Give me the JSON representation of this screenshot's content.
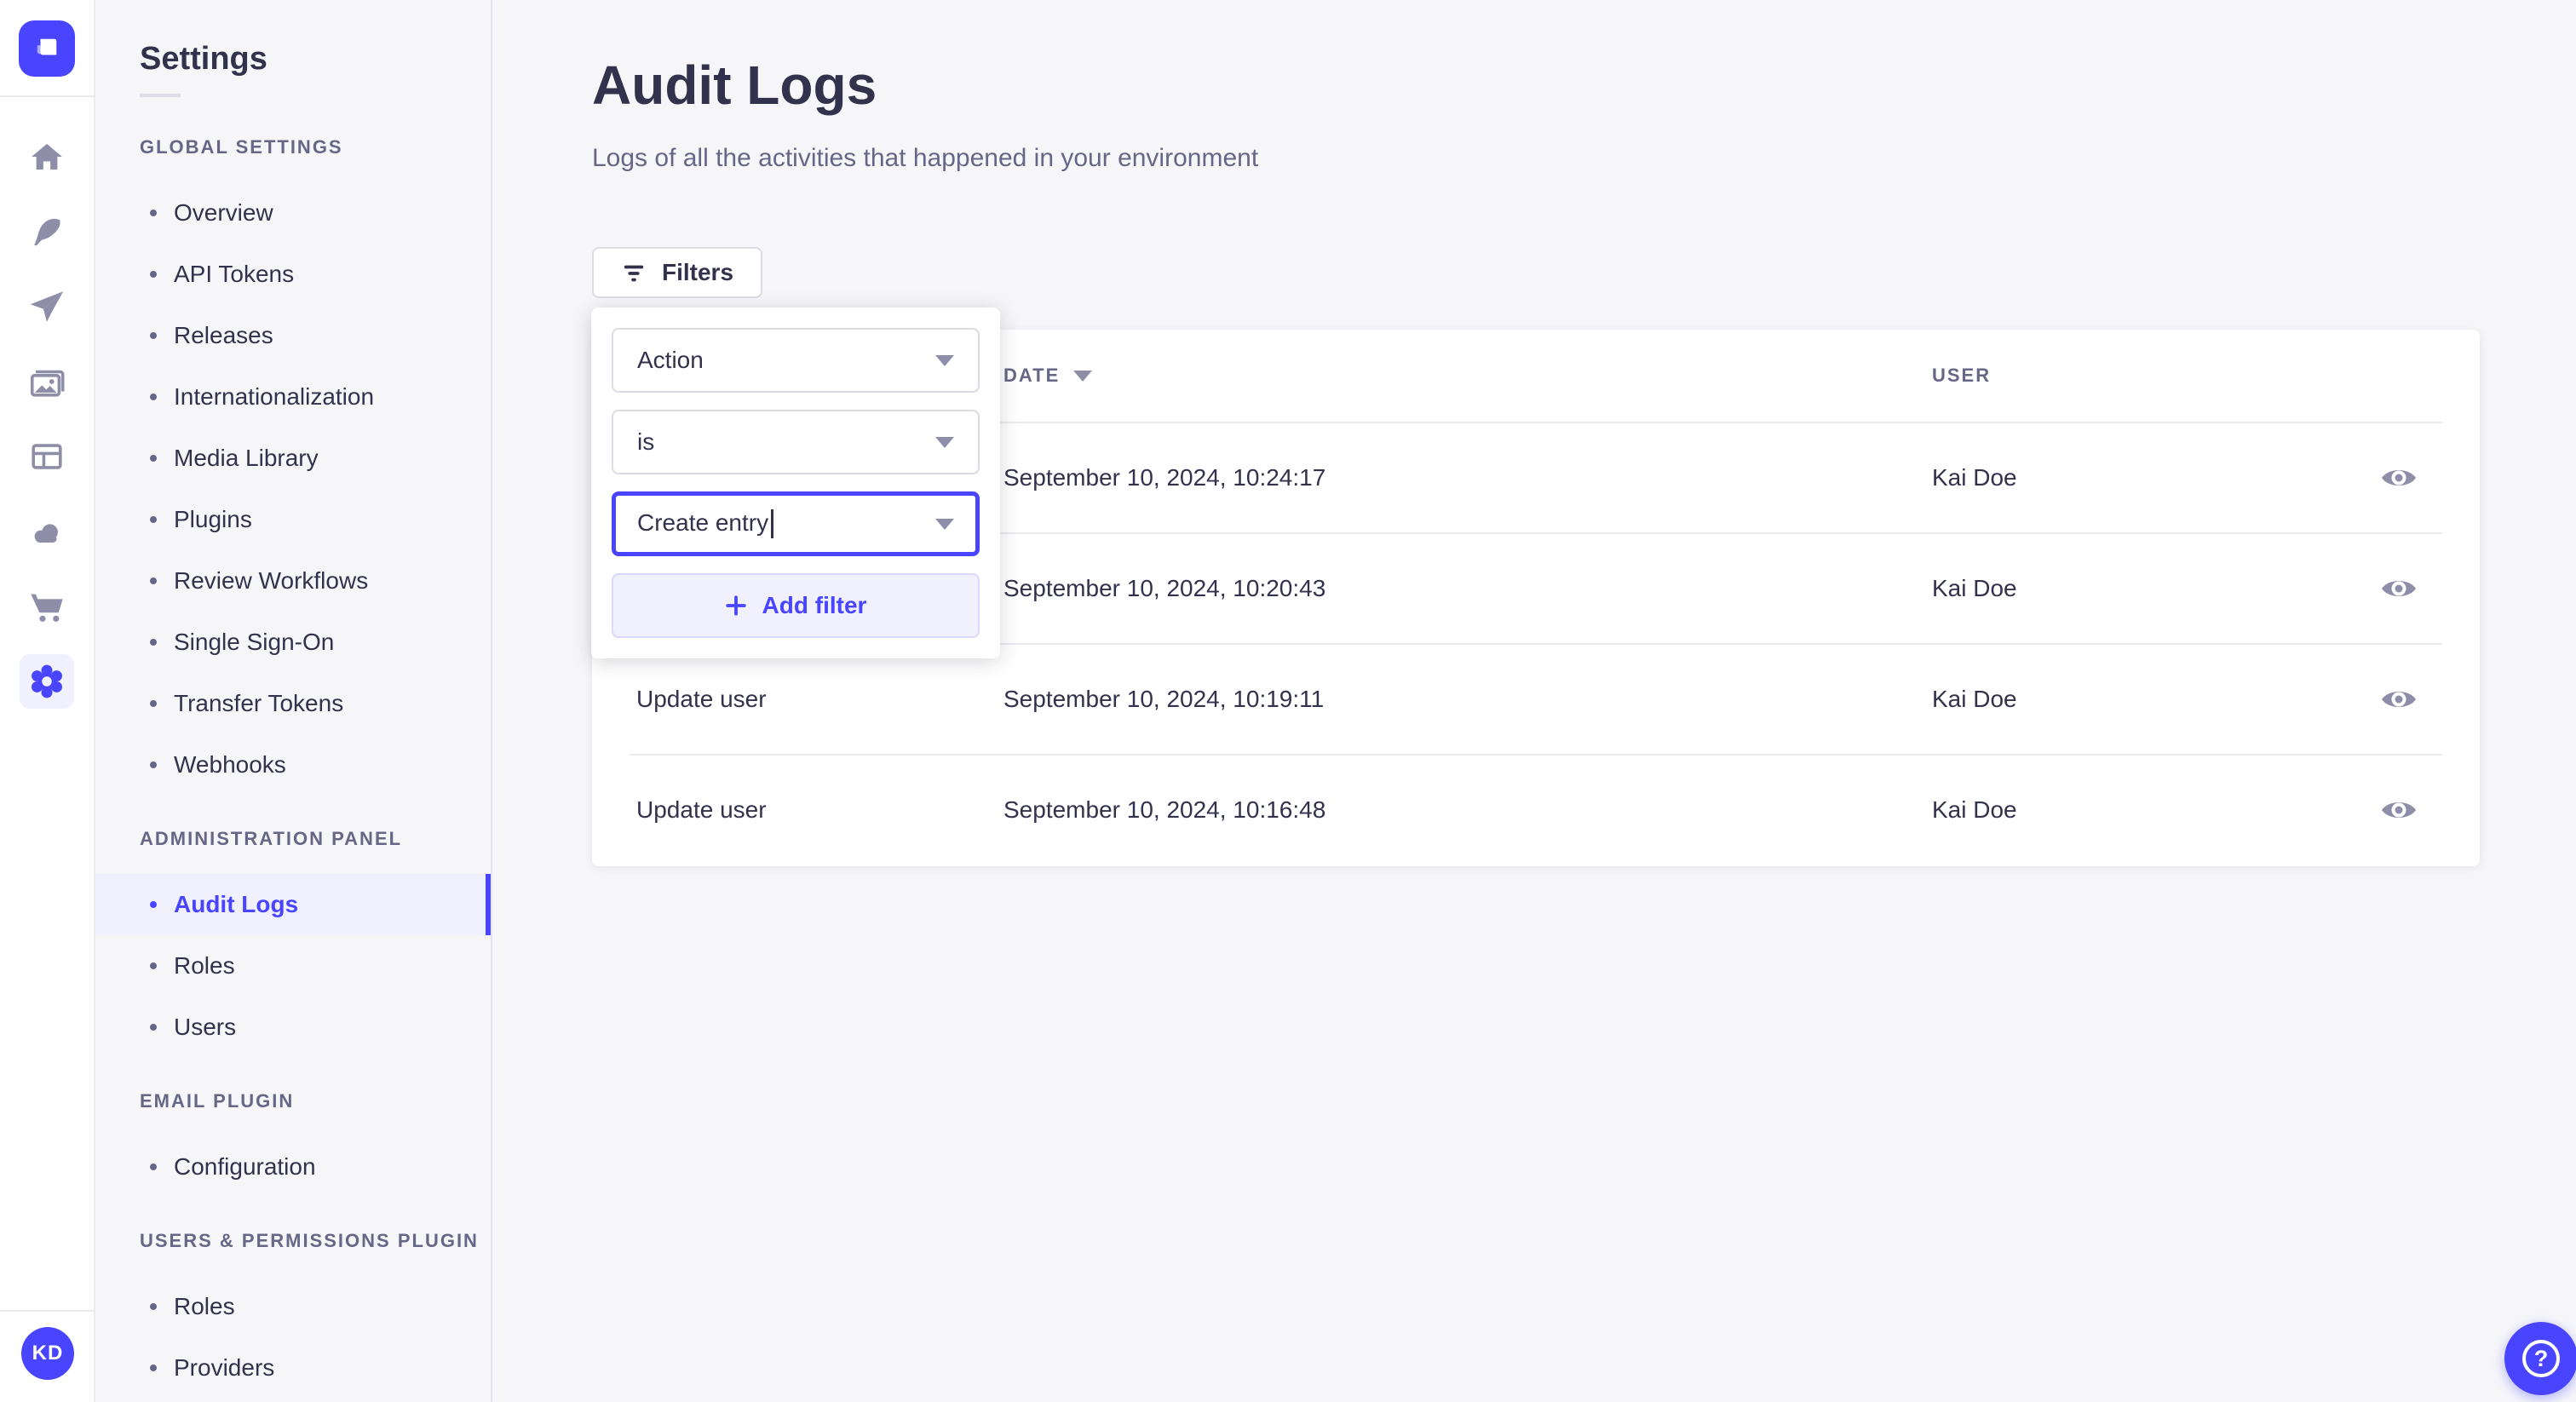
{
  "colors": {
    "accent": "#4945ff",
    "accent_light": "#f0f0ff",
    "text": "#32324d",
    "text_muted": "#666687",
    "icon_muted": "#8e8ea9",
    "border": "#dcdce4",
    "divider": "#eaeaef",
    "background": "#f6f6f9"
  },
  "rail": {
    "logo_icon": "strapi-logo",
    "items": [
      {
        "icon": "home-icon"
      },
      {
        "icon": "feather-icon"
      },
      {
        "icon": "paper-plane-icon"
      },
      {
        "icon": "media-library-icon"
      },
      {
        "icon": "content-manager-icon"
      },
      {
        "icon": "cloud-icon"
      },
      {
        "icon": "marketplace-cart-icon"
      },
      {
        "icon": "settings-gear-icon",
        "active": true
      }
    ],
    "avatar_initials": "KD"
  },
  "sidebar": {
    "title": "Settings",
    "sections": [
      {
        "label": "GLOBAL SETTINGS",
        "items": [
          {
            "label": "Overview"
          },
          {
            "label": "API Tokens"
          },
          {
            "label": "Releases"
          },
          {
            "label": "Internationalization"
          },
          {
            "label": "Media Library"
          },
          {
            "label": "Plugins"
          },
          {
            "label": "Review Workflows"
          },
          {
            "label": "Single Sign-On"
          },
          {
            "label": "Transfer Tokens"
          },
          {
            "label": "Webhooks"
          }
        ]
      },
      {
        "label": "ADMINISTRATION PANEL",
        "items": [
          {
            "label": "Audit Logs",
            "active": true
          },
          {
            "label": "Roles"
          },
          {
            "label": "Users"
          }
        ]
      },
      {
        "label": "EMAIL PLUGIN",
        "items": [
          {
            "label": "Configuration"
          }
        ]
      },
      {
        "label": "USERS & PERMISSIONS PLUGIN",
        "items": [
          {
            "label": "Roles"
          },
          {
            "label": "Providers"
          }
        ]
      }
    ]
  },
  "header": {
    "title": "Audit Logs",
    "subtitle": "Logs of all the activities that happened in your environment"
  },
  "toolbar": {
    "filters_label": "Filters"
  },
  "filter_popover": {
    "field_value": "Action",
    "operator_value": "is",
    "value_text": "Create entry",
    "add_filter_label": "Add filter"
  },
  "table": {
    "headers": {
      "action": "",
      "date": "DATE",
      "user": "USER"
    },
    "rows": [
      {
        "action": "",
        "date": "September 10, 2024, 10:24:17",
        "user": "Kai Doe"
      },
      {
        "action": "",
        "date": "September 10, 2024, 10:20:43",
        "user": "Kai Doe"
      },
      {
        "action": "Update user",
        "date": "September 10, 2024, 10:19:11",
        "user": "Kai Doe"
      },
      {
        "action": "Update user",
        "date": "September 10, 2024, 10:16:48",
        "user": "Kai Doe"
      }
    ]
  }
}
